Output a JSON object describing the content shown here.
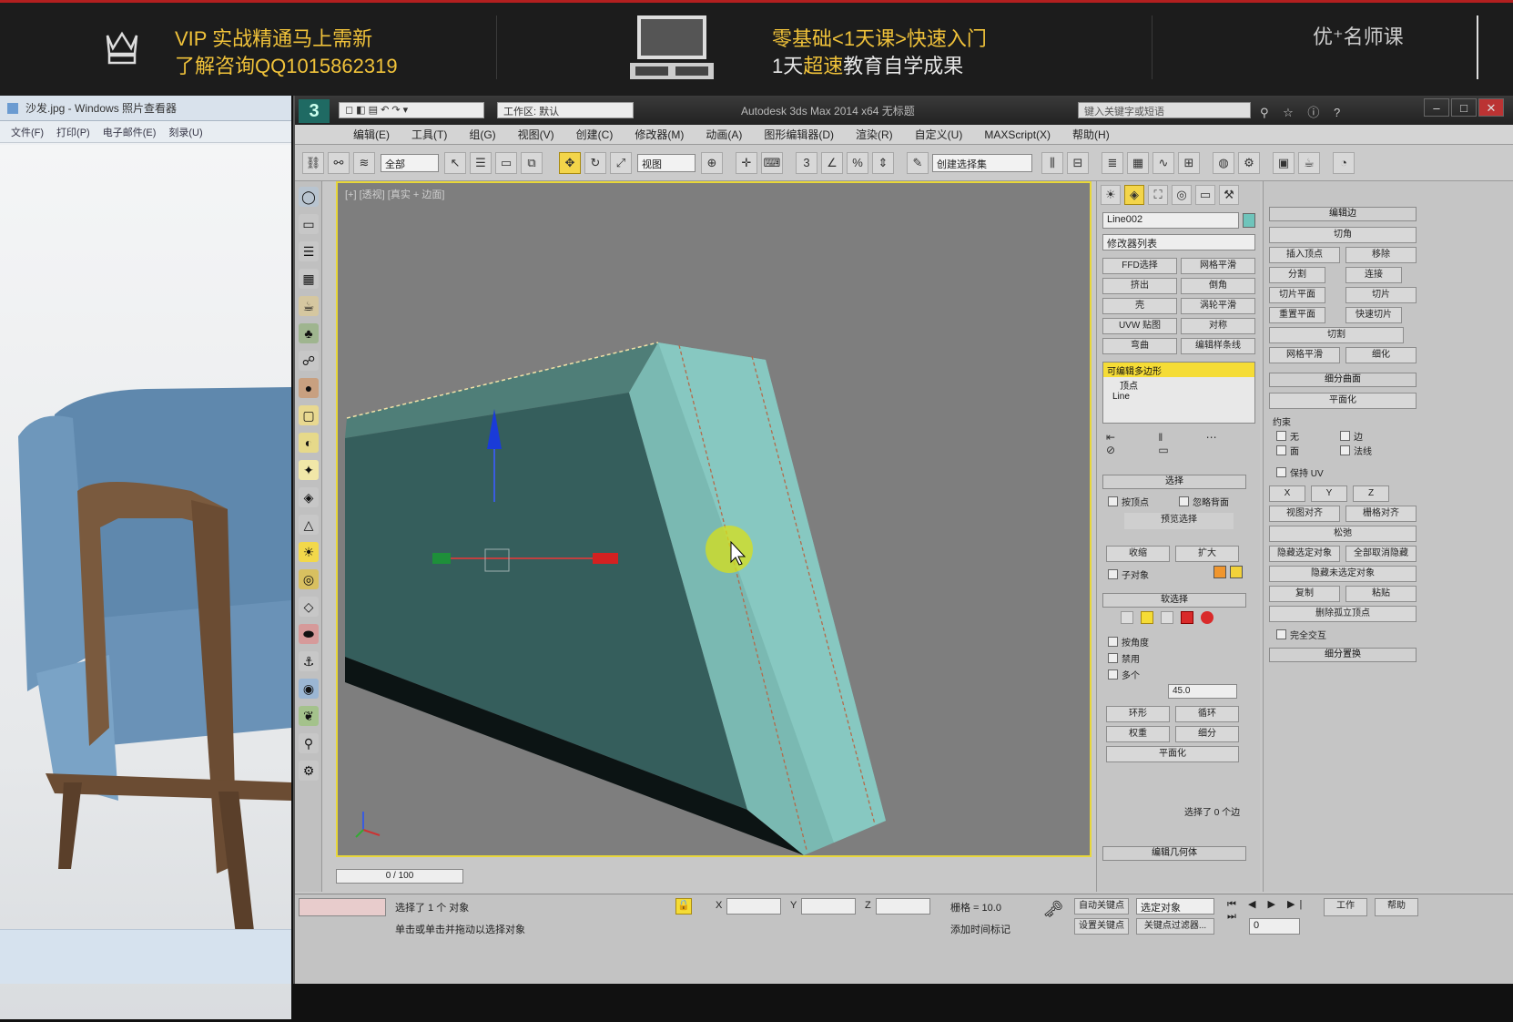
{
  "banner": {
    "left_line1": "VIP 实战精通马上需新",
    "left_line2": "了解咨询QQ1015862319",
    "mid_line1": "零基础<1天课>快速入门",
    "mid_line2_pre": "1天",
    "mid_line2_hl": "超速",
    "mid_line2_post": "教育自学成果",
    "brand": "优⁺名师课"
  },
  "viewer": {
    "title": "沙发.jpg - Windows 照片查看器",
    "menu": [
      "文件(F)",
      "打印(P)",
      "电子邮件(E)",
      "刻录(U)"
    ]
  },
  "max": {
    "quick_access": "工作区: 默认",
    "workspace": "工作区: 默认",
    "window_title": "Autodesk 3ds Max 2014 x64  无标题",
    "search": "键入关键字或短语",
    "win_min": "–",
    "win_max": "□",
    "win_close": "✕",
    "menu": [
      "编辑(E)",
      "工具(T)",
      "组(G)",
      "视图(V)",
      "创建(C)",
      "修改器(M)",
      "动画(A)",
      "图形编辑器(D)",
      "渲染(R)",
      "自定义(U)",
      "MAXScript(X)",
      "帮助(H)"
    ],
    "toolbar": {
      "filter": "全部",
      "view": "视图",
      "selset": "创建选择集"
    },
    "viewport_label": "[+] [透视] [真实 + 边面]"
  },
  "cmd": {
    "object_name": "Line002",
    "modifier_list": "修改器列表",
    "buttons": [
      "FFD选择",
      "网格平滑",
      "挤出",
      "倒角",
      "壳",
      "涡轮平滑",
      "UVW 贴图",
      "对称",
      "弯曲",
      "编辑样条线"
    ],
    "stack": [
      "编辑多边形",
      "顶点",
      "Line"
    ],
    "stack_sel": "可编辑多边形",
    "rollouts": {
      "sel_head": "选择",
      "soft_head": "软选择",
      "edit_head": "编辑几何体",
      "opt1": "按顶点",
      "opt2": "忽略背面",
      "opt3": "按角度",
      "angle_value": "45.0",
      "shrink": "收缩",
      "grow": "扩大",
      "ring": "环形",
      "loop": "循环",
      "preview": "预览选择",
      "disabled": "禁用",
      "subobj": "子对象",
      "multi": "多个",
      "sel_count": "选择了 0 个边",
      "weight": "权重",
      "subdiv": "细分",
      "planar": "平面化"
    },
    "right_buttons": [
      "切角",
      "插入顶点",
      "移除",
      "分割",
      "连接",
      "切片平面",
      "切片",
      "重置平面",
      "快速切片",
      "切割",
      "网格平滑",
      "细化",
      "平面化",
      "X",
      "Y",
      "Z",
      "视图对齐",
      "栅格对齐",
      "松弛",
      "隐藏选定对象",
      "全部取消隐藏",
      "隐藏未选定对象",
      "复制",
      "粘贴",
      "删除孤立顶点",
      "完全交互"
    ],
    "right_heads": [
      "编辑边",
      "细分曲面",
      "细分置换"
    ],
    "right_labels": [
      "约束",
      "无",
      "边",
      "面",
      "法线",
      "保持 UV"
    ]
  },
  "status": {
    "selected": "选择了 1 个 对象",
    "prompt": "单击或单击并拖动以选择对象",
    "x": "",
    "y": "",
    "z": "",
    "grid": "栅格 = 10.0",
    "autokey": "自动关键点",
    "setkey": "设置关键点",
    "selected_dd": "选定对象",
    "key_filter": "关键点过滤器...",
    "add_tag": "添加时间标记",
    "frame": "0",
    "timeline": "0 / 100",
    "workspace_btn": "工作",
    "help_btn": "帮助"
  }
}
